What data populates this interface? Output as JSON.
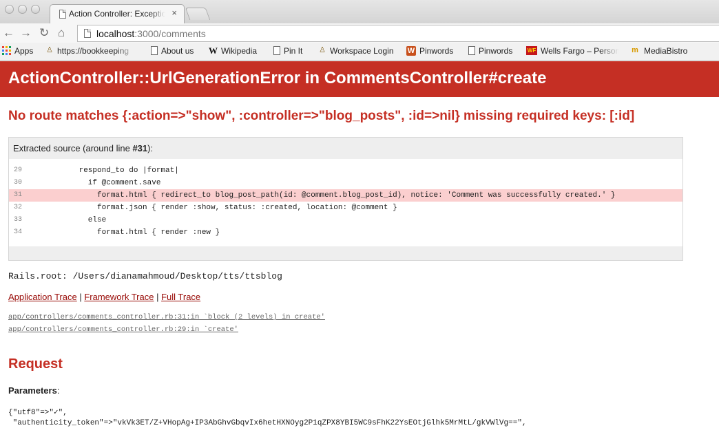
{
  "browser": {
    "tab_title": "Action Controller: Exception caught",
    "tab_close": "×",
    "url_host": "localhost",
    "url_rest": ":3000/comments",
    "nav": {
      "back": "←",
      "forward": "→",
      "reload": "↻",
      "home": "⌂"
    }
  },
  "bookmarks": [
    {
      "label": "Apps",
      "icon": "apps-grid-icon"
    },
    {
      "label": "https://bookkeeping",
      "icon": "bot-icon"
    },
    {
      "label": "About us",
      "icon": "page-icon"
    },
    {
      "label": "Wikipedia",
      "icon": "wikipedia-icon"
    },
    {
      "label": "Pin It",
      "icon": "page-icon"
    },
    {
      "label": "Workspace Login",
      "icon": "bot-icon"
    },
    {
      "label": "Pinwords",
      "icon": "pinwords-icon"
    },
    {
      "label": "Pinwords",
      "icon": "page-icon"
    },
    {
      "label": "Wells Fargo – Personal",
      "icon": "wells-fargo-icon"
    },
    {
      "label": "MediaBistro",
      "icon": "mediabistro-icon"
    }
  ],
  "icon_glyphs": {
    "wikipedia": "W",
    "pinwords": "W",
    "wells_fargo": "WF",
    "mediabistro": "m",
    "bot": "♙"
  },
  "error": {
    "title": "ActionController::UrlGenerationError in CommentsController#create",
    "message": "No route matches {:action=>\"show\", :controller=>\"blog_posts\", :id=>nil} missing required keys: [:id]"
  },
  "source": {
    "caption_prefix": "Extracted source (around line ",
    "caption_line": "#31",
    "caption_suffix": "):",
    "highlight_line": 31,
    "lines": [
      {
        "num": "29",
        "code": "      respond_to do |format|"
      },
      {
        "num": "30",
        "code": "        if @comment.save"
      },
      {
        "num": "31",
        "code": "          format.html { redirect_to blog_post_path(id: @comment.blog_post_id), notice: 'Comment was successfully created.' }"
      },
      {
        "num": "32",
        "code": "          format.json { render :show, status: :created, location: @comment }"
      },
      {
        "num": "33",
        "code": "        else"
      },
      {
        "num": "34",
        "code": "          format.html { render :new }"
      }
    ]
  },
  "rails_root": "Rails.root: /Users/dianamahmoud/Desktop/tts/ttsblog",
  "traces": {
    "application": "Application Trace",
    "framework": "Framework Trace",
    "full": "Full Trace",
    "separator": " | ",
    "lines": [
      "app/controllers/comments_controller.rb:31:in `block (2 levels) in create'",
      "app/controllers/comments_controller.rb:29:in `create'"
    ]
  },
  "request": {
    "heading": "Request",
    "params_label": "Parameters",
    "params_colon": ":",
    "params_lines": [
      "{\"utf8\"=>\"✓\",",
      " \"authenticity_token\"=>\"vkVk3ET/Z+VHopAg+IP3AbGhvGbqvIx6hetHXNOyg2P1qZPX8YBI5WC9sFhK22YsEOtjGlhk5MrMtL/gkVWlVg==\","
    ]
  },
  "colors": {
    "accent_red": "#c52f24",
    "link_red": "#980905",
    "highlight": "#fbcfcf"
  }
}
